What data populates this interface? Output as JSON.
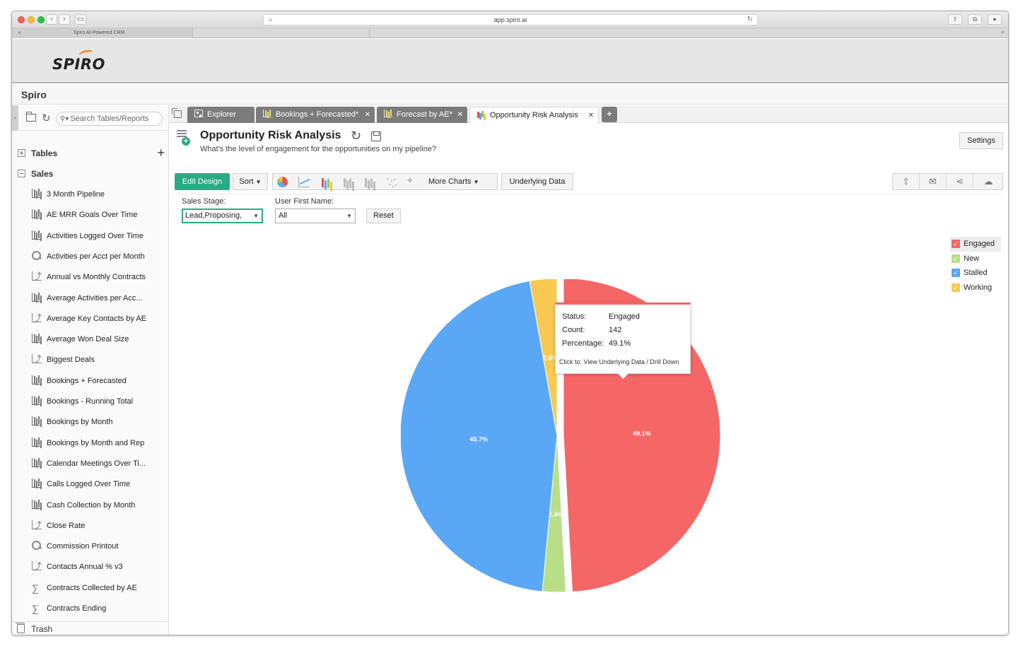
{
  "browser": {
    "url": "app.spiro.ai",
    "tab_title": "Spiro AI-Powered CRM"
  },
  "app": {
    "logo_text": "SPIRO",
    "name": "Spiro"
  },
  "sidebar": {
    "search_placeholder": "Search Tables/Reports",
    "tables_label": "Tables",
    "sales_label": "Sales",
    "reports": [
      {
        "label": "3 Month Pipeline",
        "icon": "bar-chart-icon"
      },
      {
        "label": "AE MRR Goals Over Time",
        "icon": "bar-chart-icon"
      },
      {
        "label": "Activities Logged Over Time",
        "icon": "bar-chart-icon"
      },
      {
        "label": "Activities per Acct per Month",
        "icon": "query-icon"
      },
      {
        "label": "Annual vs Monthly Contracts",
        "icon": "line-chart-icon"
      },
      {
        "label": "Average Activities per Acc...",
        "icon": "bar-chart-icon"
      },
      {
        "label": "Average Key Contacts by AE",
        "icon": "line-chart-icon"
      },
      {
        "label": "Average Won Deal Size",
        "icon": "bar-chart-icon"
      },
      {
        "label": "Biggest Deals",
        "icon": "line-chart-icon"
      },
      {
        "label": "Bookings + Forecasted",
        "icon": "bar-chart-icon"
      },
      {
        "label": "Bookings - Running Total",
        "icon": "bar-chart-icon"
      },
      {
        "label": "Bookings by Month",
        "icon": "bar-chart-icon"
      },
      {
        "label": "Bookings by Month and Rep",
        "icon": "bar-chart-icon"
      },
      {
        "label": "Calendar Meetings Over Ti...",
        "icon": "bar-chart-icon"
      },
      {
        "label": "Calls Logged Over Time",
        "icon": "bar-chart-icon"
      },
      {
        "label": "Cash Collection by Month",
        "icon": "bar-chart-icon"
      },
      {
        "label": "Close Rate",
        "icon": "line-chart-icon"
      },
      {
        "label": "Commission Printout",
        "icon": "query-icon"
      },
      {
        "label": "Contacts Annual % v3",
        "icon": "line-chart-icon"
      },
      {
        "label": "Contracts Collected by AE",
        "icon": "sigma-icon"
      },
      {
        "label": "Contracts Ending",
        "icon": "sigma-icon"
      }
    ],
    "trash_label": "Trash"
  },
  "tabs": {
    "items": [
      {
        "label": "Explorer",
        "modified": false
      },
      {
        "label": "Bookings + Forecasted",
        "modified": true
      },
      {
        "label": "Forecast by AE",
        "modified": true
      },
      {
        "label": "Opportunity Risk Analysis",
        "modified": false
      }
    ],
    "modified_marker": "*",
    "add_label": "+"
  },
  "report": {
    "title": "Opportunity Risk Analysis",
    "description": "What's the level of engagement for the opportunities on my pipeline?",
    "settings_label": "Settings"
  },
  "toolbar": {
    "edit_design": "Edit Design",
    "sort": "Sort",
    "more_charts": "More Charts",
    "underlying_data": "Underlying Data",
    "chart_type_icons": [
      "pie-chart-icon",
      "line-chart-icon",
      "column-chart-icon",
      "stacked-chart-icon",
      "grouped-chart-icon",
      "scatter-chart-icon",
      "map-chart-icon"
    ],
    "right_icons": [
      "export-icon",
      "email-icon",
      "share-icon",
      "publish-cloud-icon"
    ]
  },
  "filters": {
    "sales_stage_label": "Sales Stage:",
    "sales_stage_value": "Lead,Proposing,",
    "user_first_name_label": "User First Name:",
    "user_first_name_value": "All",
    "reset_label": "Reset"
  },
  "chart_data": {
    "type": "pie",
    "categories": [
      "Engaged",
      "New",
      "Stalled",
      "Working"
    ],
    "values": [
      49.1,
      2.4,
      45.7,
      2.8
    ],
    "value_unit": "%",
    "slice_labels": [
      "49.1%",
      "2.4%",
      "45.7%",
      "2.8%"
    ],
    "colors": [
      "#f56666",
      "#b8df88",
      "#5aa7f5",
      "#f9c952"
    ],
    "legend_placement": "top-right",
    "exploded": "Engaged"
  },
  "tooltip": {
    "status_label": "Status:",
    "status_value": "Engaged",
    "count_label": "Count:",
    "count_value": "142",
    "percentage_label": "Percentage:",
    "percentage_value": "49.1%",
    "hint": "Click to: View Underlying Data / Drill Down"
  }
}
